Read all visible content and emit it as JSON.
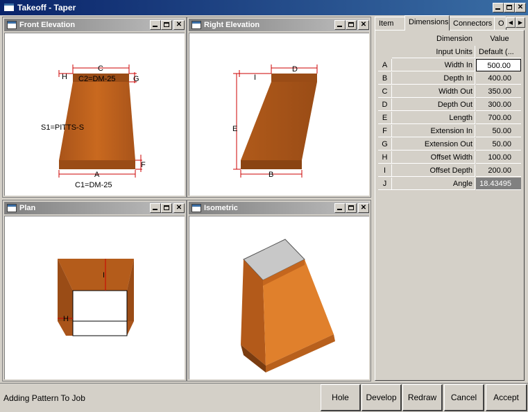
{
  "window": {
    "title": "Takeoff - Taper"
  },
  "panes": {
    "front": {
      "title": "Front Elevation",
      "labels": {
        "C": "C",
        "H": "H",
        "C2": "C2=DM-25",
        "G": "G",
        "S1": "S1=PITTS-S",
        "F": "F",
        "A": "A",
        "C1": "C1=DM-25"
      }
    },
    "right": {
      "title": "Right Elevation",
      "labels": {
        "D": "D",
        "I": "I",
        "E": "E",
        "B": "B"
      }
    },
    "plan": {
      "title": "Plan",
      "labels": {
        "I": "I",
        "H": "H"
      }
    },
    "iso": {
      "title": "Isometric"
    }
  },
  "tabs": [
    "Item",
    "Dimensions",
    "Connectors",
    "O"
  ],
  "active_tab": "Dimensions",
  "grid": {
    "header_dimension": "Dimension",
    "header_value": "Value",
    "input_units_label": "Input Units",
    "input_units_value": "Default (...",
    "rows": [
      {
        "letter": "A",
        "name": "Width In",
        "value": "500.00"
      },
      {
        "letter": "B",
        "name": "Depth In",
        "value": "400.00"
      },
      {
        "letter": "C",
        "name": "Width Out",
        "value": "350.00"
      },
      {
        "letter": "D",
        "name": "Depth Out",
        "value": "300.00"
      },
      {
        "letter": "E",
        "name": "Length",
        "value": "700.00"
      },
      {
        "letter": "F",
        "name": "Extension In",
        "value": "50.00"
      },
      {
        "letter": "G",
        "name": "Extension Out",
        "value": "50.00"
      },
      {
        "letter": "H",
        "name": "Offset Width",
        "value": "100.00"
      },
      {
        "letter": "I",
        "name": "Offset Depth",
        "value": "200.00"
      },
      {
        "letter": "J",
        "name": "Angle",
        "value": "18.43495"
      }
    ]
  },
  "status": {
    "text": "Adding Pattern To Job"
  },
  "buttons": {
    "hole": "Hole",
    "develop": "Develop",
    "redraw": "Redraw",
    "cancel": "Cancel",
    "accept": "Accept"
  },
  "colors": {
    "metal": "#c0651c",
    "metal_dark": "#8e4a14",
    "dim_line": "#cc0000",
    "title_active": "#0a246a"
  }
}
